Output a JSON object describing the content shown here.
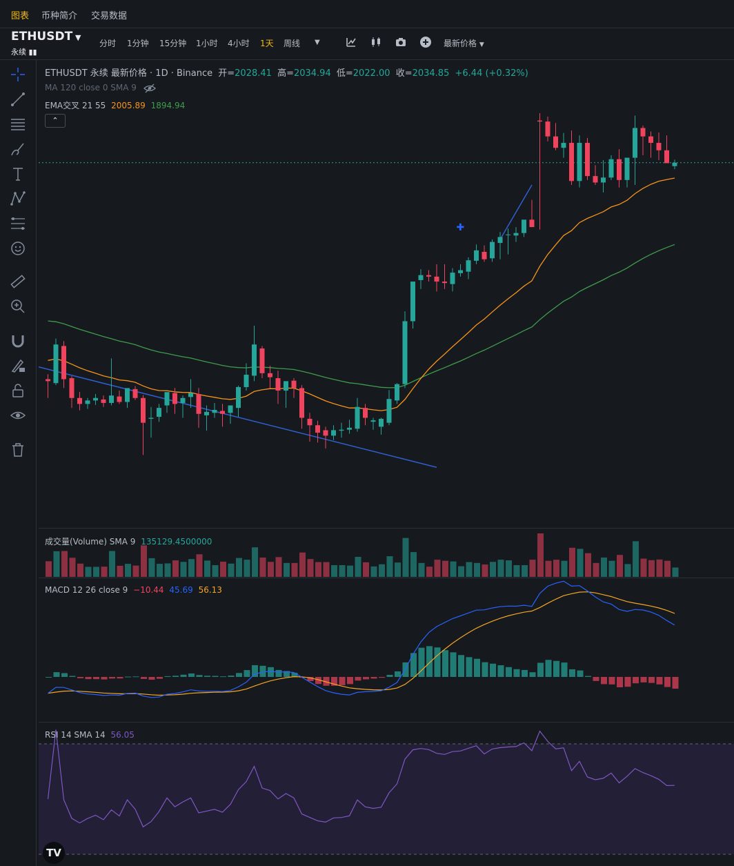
{
  "top_nav": {
    "tabs": [
      "图表",
      "币种简介",
      "交易数据"
    ]
  },
  "symbol": {
    "name": "ETHUSDT",
    "sub": "永续"
  },
  "timeframes": [
    "分时",
    "1分钟",
    "15分钟",
    "1小时",
    "4小时",
    "1天",
    "周线"
  ],
  "active_timeframe": "1天",
  "price_type_label": "最新价格",
  "legend": {
    "main": "ETHUSDT 永续 最新价格 · 1D · Binance",
    "open_label": "开=",
    "open": "2028.41",
    "high_label": "高=",
    "high": "2034.94",
    "low_label": "低=",
    "low": "2022.00",
    "close_label": "收=",
    "close": "2034.85",
    "change": "+6.44 (+0.32%)",
    "ma_line": "MA 120 close 0 SMA 9",
    "ema_label": "EMA交叉 21 55",
    "ema_fast": "2005.89",
    "ema_slow": "1894.94",
    "volume_label": "成交量(Volume) SMA 9",
    "volume_value": "135129.4500000",
    "macd_label": "MACD 12 26 close 9",
    "macd_hist": "−10.44",
    "macd_line": "45.69",
    "macd_signal": "56.13",
    "rsi_label": "RSI 14 SMA 14",
    "rsi_value": "56.05"
  },
  "icons": [
    "crosshair-icon",
    "trendline-icon",
    "horizontal-lines-icon",
    "brush-icon",
    "text-icon",
    "pattern-icon",
    "fib-icon",
    "emoji-icon",
    "ruler-icon",
    "zoom-in-icon",
    "magnet-icon",
    "lock-draw-icon",
    "lock-icon",
    "eye-icon",
    "trash-icon"
  ],
  "colors": {
    "up": "#26a69a",
    "down": "#f0435e",
    "ema_fast": "#f7931a",
    "ema_slow": "#3f9c4c",
    "trend": "#2f5fd0",
    "macd": "#2962ff",
    "signal": "#f5a623",
    "rsi": "#7e57c2",
    "accent": "#f0b90b"
  },
  "chart_data": {
    "type": "candlestick",
    "symbol": "ETHUSDT",
    "interval": "1D",
    "candles": [
      [
        1598,
        1608,
        1560,
        1594
      ],
      [
        1590,
        1680,
        1586,
        1668
      ],
      [
        1665,
        1675,
        1580,
        1598
      ],
      [
        1600,
        1604,
        1540,
        1560
      ],
      [
        1560,
        1572,
        1535,
        1548
      ],
      [
        1548,
        1560,
        1538,
        1555
      ],
      [
        1555,
        1568,
        1546,
        1560
      ],
      [
        1557,
        1565,
        1542,
        1550
      ],
      [
        1550,
        1640,
        1545,
        1565
      ],
      [
        1563,
        1575,
        1548,
        1552
      ],
      [
        1552,
        1576,
        1540,
        1580
      ],
      [
        1578,
        1584,
        1556,
        1560
      ],
      [
        1560,
        1566,
        1445,
        1510
      ],
      [
        1518,
        1542,
        1480,
        1520
      ],
      [
        1522,
        1548,
        1512,
        1540
      ],
      [
        1545,
        1568,
        1530,
        1572
      ],
      [
        1570,
        1580,
        1528,
        1548
      ],
      [
        1550,
        1565,
        1520,
        1560
      ],
      [
        1562,
        1598,
        1540,
        1570
      ],
      [
        1568,
        1580,
        1500,
        1528
      ],
      [
        1525,
        1545,
        1494,
        1532
      ],
      [
        1530,
        1550,
        1520,
        1536
      ],
      [
        1534,
        1548,
        1502,
        1528
      ],
      [
        1530,
        1545,
        1508,
        1545
      ],
      [
        1540,
        1585,
        1522,
        1582
      ],
      [
        1582,
        1630,
        1575,
        1607
      ],
      [
        1605,
        1706,
        1594,
        1668
      ],
      [
        1660,
        1665,
        1600,
        1610
      ],
      [
        1610,
        1625,
        1580,
        1602
      ],
      [
        1600,
        1615,
        1548,
        1575
      ],
      [
        1575,
        1580,
        1540,
        1594
      ],
      [
        1595,
        1600,
        1560,
        1580
      ],
      [
        1580,
        1586,
        1498,
        1520
      ],
      [
        1518,
        1530,
        1472,
        1505
      ],
      [
        1505,
        1514,
        1470,
        1490
      ],
      [
        1495,
        1502,
        1458,
        1484
      ],
      [
        1484,
        1505,
        1475,
        1495
      ],
      [
        1494,
        1510,
        1480,
        1496
      ],
      [
        1496,
        1516,
        1488,
        1500
      ],
      [
        1498,
        1560,
        1492,
        1542
      ],
      [
        1540,
        1548,
        1505,
        1520
      ],
      [
        1512,
        1520,
        1496,
        1515
      ],
      [
        1502,
        1520,
        1486,
        1518
      ],
      [
        1510,
        1576,
        1505,
        1558
      ],
      [
        1555,
        1590,
        1548,
        1588
      ],
      [
        1588,
        1735,
        1580,
        1715
      ],
      [
        1715,
        1790,
        1700,
        1795
      ],
      [
        1798,
        1820,
        1780,
        1808
      ],
      [
        1808,
        1818,
        1795,
        1805
      ],
      [
        1805,
        1830,
        1775,
        1795
      ],
      [
        1795,
        1830,
        1780,
        1792
      ],
      [
        1790,
        1822,
        1775,
        1813
      ],
      [
        1812,
        1830,
        1805,
        1818
      ],
      [
        1815,
        1844,
        1800,
        1838
      ],
      [
        1837,
        1870,
        1830,
        1858
      ],
      [
        1855,
        1868,
        1835,
        1840
      ],
      [
        1842,
        1880,
        1835,
        1875
      ],
      [
        1873,
        1895,
        1840,
        1885
      ],
      [
        1890,
        1902,
        1850,
        1890
      ],
      [
        1888,
        1905,
        1875,
        1893
      ],
      [
        1893,
        1915,
        1885,
        1920
      ],
      [
        1920,
        1960,
        1905,
        1905
      ],
      [
        2120,
        2135,
        1900,
        2118
      ],
      [
        2118,
        2128,
        2078,
        2088
      ],
      [
        2088,
        2115,
        2060,
        2065
      ],
      [
        2065,
        2095,
        2045,
        2075
      ],
      [
        2075,
        2100,
        1990,
        1998
      ],
      [
        1998,
        2090,
        1985,
        2075
      ],
      [
        2075,
        2085,
        2000,
        2008
      ],
      [
        2008,
        2030,
        1990,
        1995
      ],
      [
        1995,
        2040,
        1975,
        2005
      ],
      [
        2005,
        2050,
        2000,
        2042
      ],
      [
        2042,
        2062,
        1985,
        2000
      ],
      [
        2000,
        2020,
        1985,
        2045
      ],
      [
        2045,
        2130,
        1990,
        2105
      ],
      [
        2105,
        2110,
        2050,
        2088
      ],
      [
        2088,
        2098,
        2045,
        2075
      ],
      [
        2075,
        2096,
        2040,
        2060
      ],
      [
        2060,
        2090,
        2040,
        2034
      ],
      [
        2028,
        2041,
        2022,
        2035
      ]
    ]
  }
}
